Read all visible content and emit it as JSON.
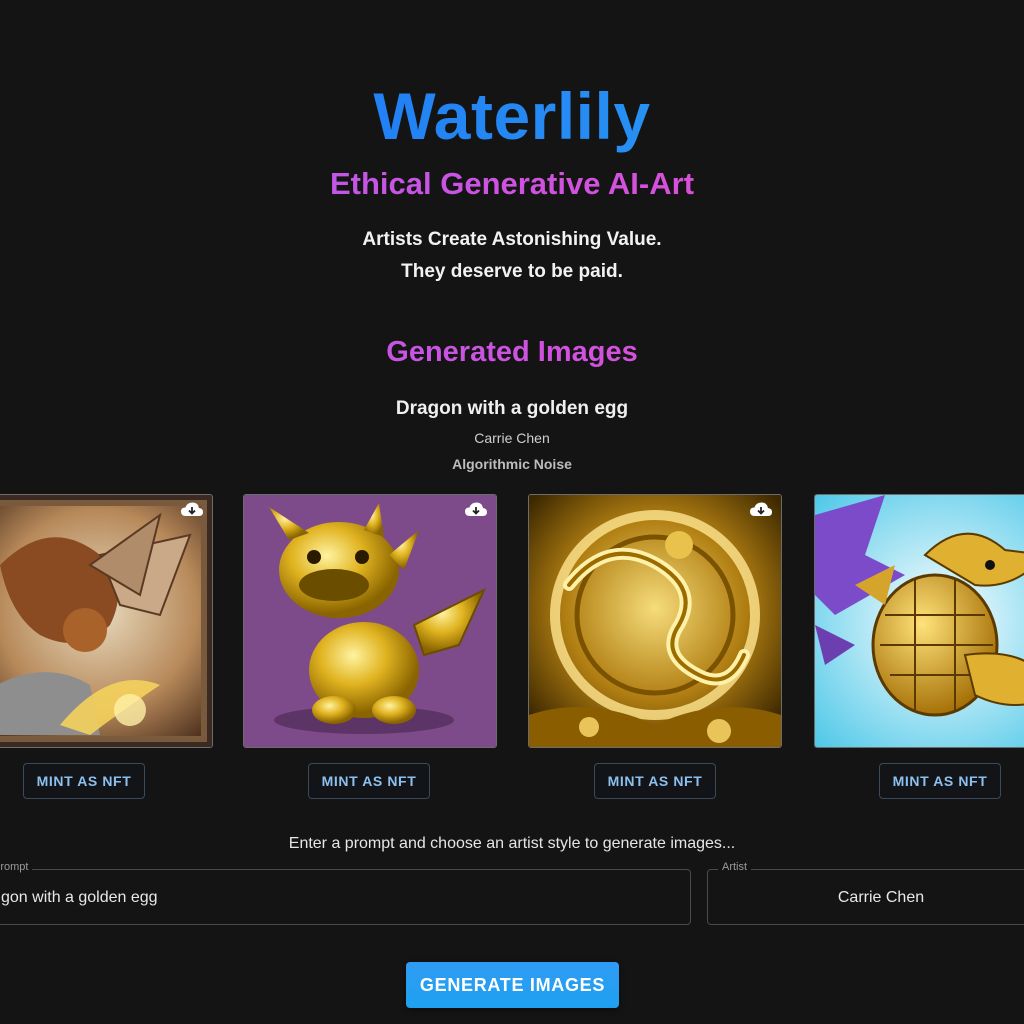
{
  "header": {
    "title": "Waterlily",
    "tagline": "Ethical Generative AI-Art",
    "intro_line_1": "Artists Create Astonishing Value.",
    "intro_line_2": "They deserve to be paid."
  },
  "results": {
    "section_title": "Generated Images",
    "prompt": "Dragon with a golden egg",
    "artist": "Carrie Chen",
    "style": "Algorithmic Noise",
    "images": [
      {
        "mint_label": "MINT AS NFT",
        "icon": "cloud-download-icon"
      },
      {
        "mint_label": "MINT AS NFT",
        "icon": "cloud-download-icon"
      },
      {
        "mint_label": "MINT AS NFT",
        "icon": "cloud-download-icon"
      },
      {
        "mint_label": "MINT AS NFT",
        "icon": "cloud-download-icon"
      }
    ]
  },
  "form": {
    "instructions": "Enter a prompt and choose an artist style to generate images...",
    "prompt_label": "Prompt",
    "prompt_value": "gon with a golden egg",
    "artist_label": "Artist",
    "artist_value": "Carrie Chen",
    "generate_label": "GENERATE IMAGES"
  },
  "colors": {
    "background": "#141414",
    "title_gradient": [
      "#1a6cf5",
      "#2fa5f2"
    ],
    "accent_gradient": [
      "#b05cf0",
      "#ea4ad0"
    ],
    "button": "#1ea0f0",
    "mint_text": "#8cc0ef"
  }
}
